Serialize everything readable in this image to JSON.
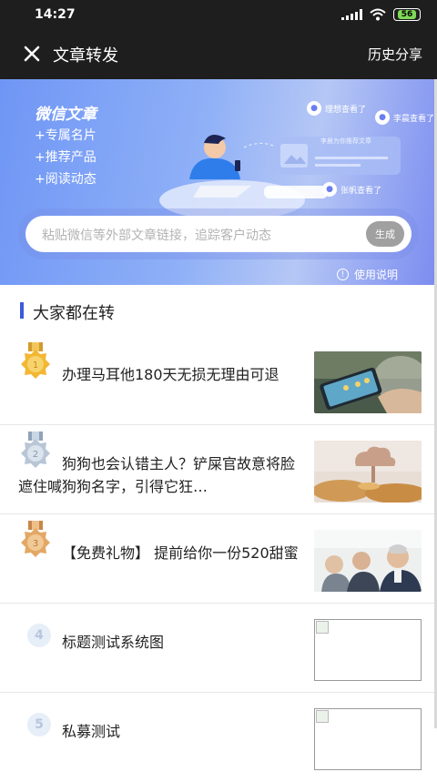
{
  "status": {
    "time": "14:27",
    "battery": "56"
  },
  "topbar": {
    "close_icon": "close-icon",
    "title": "文章转发",
    "history": "历史分享"
  },
  "banner": {
    "heading": "微信文章",
    "features": [
      "+专属名片",
      "+推荐产品",
      "+阅读动态"
    ],
    "viewers": [
      "理想查看了",
      "李晨查看了",
      "张帆查看了"
    ],
    "card_text": "李晨为你推荐文章",
    "search_placeholder": "粘贴微信等外部文章链接，追踪客户动态",
    "generate": "生成",
    "help": "使用说明"
  },
  "section": {
    "title": "大家都在转"
  },
  "articles": [
    {
      "rank": "1",
      "title": "办理马耳他180天无损无理由可退",
      "medal": "gold",
      "thumb": "phone-coins"
    },
    {
      "rank": "2",
      "title": "狗狗也会认错主人？铲屎官故意将脸遮住喊狗狗名字，引得它狂…",
      "medal": "silver",
      "thumb": "coins-cloud"
    },
    {
      "rank": "3",
      "title": "【免费礼物】 提前给你一份520甜蜜",
      "medal": "bronze",
      "thumb": "audience"
    },
    {
      "rank": "4",
      "title": "标题测试系统图",
      "medal": "none",
      "thumb": "broken"
    },
    {
      "rank": "5",
      "title": "私募测试",
      "medal": "none",
      "thumb": "broken"
    }
  ],
  "colors": {
    "accent": "#3b5bd9",
    "bar_bg": "#1e1e1e",
    "gold": "#f2b733",
    "silver": "#b8c6d6",
    "bronze": "#e3a865"
  }
}
